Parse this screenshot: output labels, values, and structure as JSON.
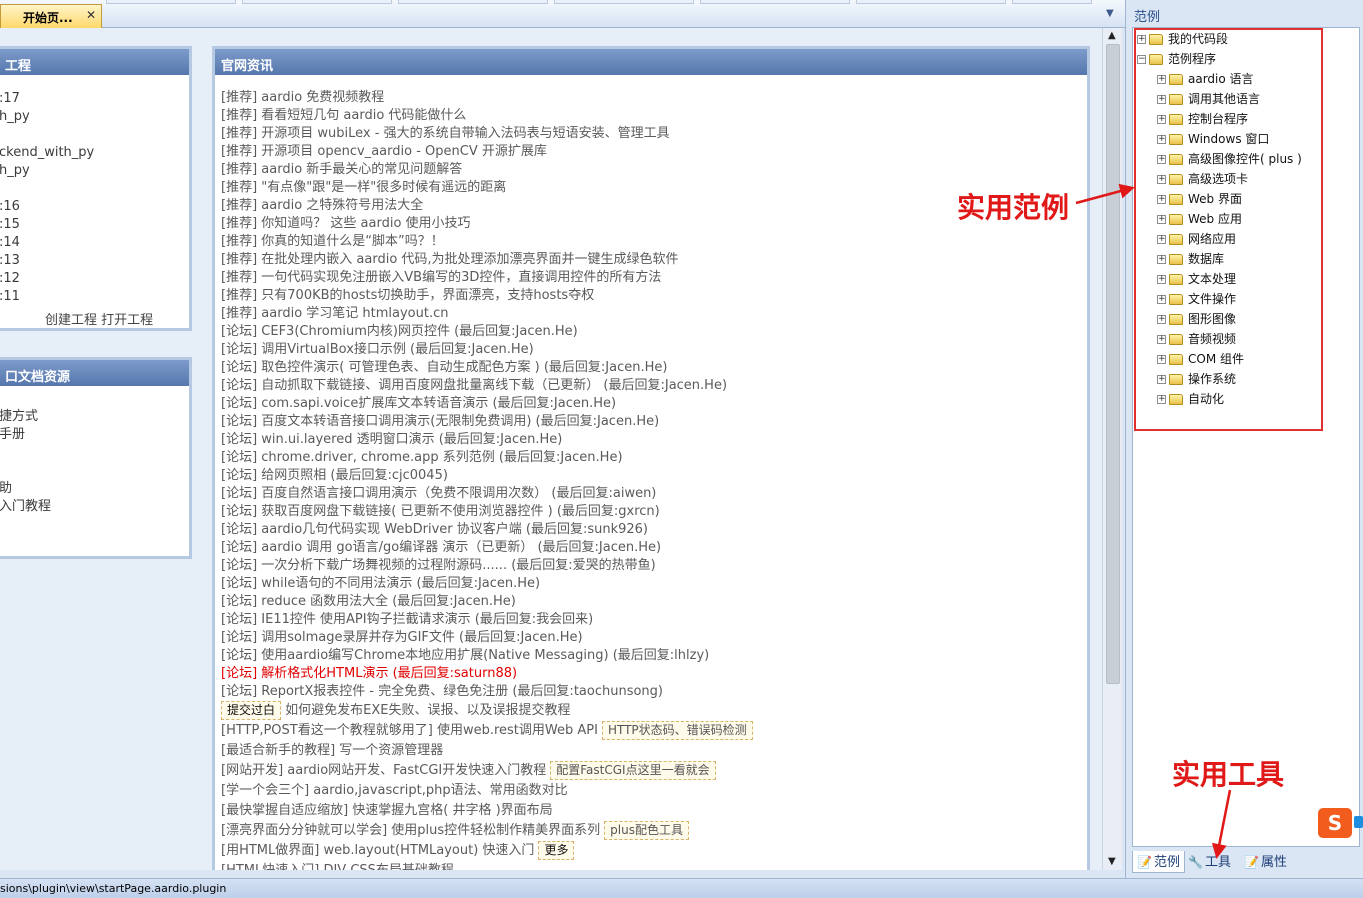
{
  "tab": {
    "label": "开始页...",
    "close": "✕"
  },
  "start_page": {
    "project_panel": {
      "title": "工程",
      "items": [
        ":17",
        "h_py",
        "",
        "ckend_with_py",
        "h_py",
        "",
        ":16",
        ":15",
        ":14",
        ":13",
        ":12",
        ":11"
      ],
      "create_link": "创建工程",
      "open_link": "打开工程"
    },
    "docs_panel": {
      "title": "口文档资源",
      "items": [
        "",
        "捷方式",
        "手册",
        "",
        "",
        "助",
        "入门教程"
      ]
    },
    "news_panel": {
      "title": "官网资讯",
      "items": [
        "[推荐] aardio 免费视频教程",
        "[推荐] 看看短短几句 aardio 代码能做什么",
        "[推荐] 开源项目 wubiLex - 强大的系统自带输入法码表与短语安装、管理工具",
        "[推荐] 开源项目 opencv_aardio - OpenCV 开源扩展库",
        "[推荐] aardio 新手最关心的常见问题解答",
        "[推荐] \"有点像\"跟\"是一样\"很多时候有遥远的距离",
        "[推荐] aardio 之特殊符号用法大全",
        "[推荐] 你知道吗？ 这些 aardio 使用小技巧",
        "[推荐] 你真的知道什么是“脚本”吗？！",
        "[推荐] 在批处理内嵌入 aardio 代码,为批处理添加漂亮界面并一键生成绿色软件",
        "[推荐] 一句代码实现免注册嵌入VB编写的3D控件，直接调用控件的所有方法",
        "[推荐] 只有700KB的hosts切换助手，界面漂亮，支持hosts夺权",
        "[推荐] aardio 学习笔记 htmlayout.cn",
        "[论坛] CEF3(Chromium内核)网页控件 (最后回复:Jacen.He)",
        "[论坛] 调用VirtualBox接口示例 (最后回复:Jacen.He)",
        "[论坛] 取色控件演示( 可管理色表、自动生成配色方案 ) (最后回复:Jacen.He)",
        "[论坛] 自动抓取下载链接、调用百度网盘批量离线下载（已更新） (最后回复:Jacen.He)",
        "[论坛] com.sapi.voice扩展库文本转语音演示 (最后回复:Jacen.He)",
        "[论坛] 百度文本转语音接口调用演示(无限制免费调用) (最后回复:Jacen.He)",
        "[论坛] win.ui.layered 透明窗口演示 (最后回复:Jacen.He)",
        "[论坛] chrome.driver, chrome.app 系列范例 (最后回复:Jacen.He)",
        "[论坛] 给网页照相 (最后回复:cjc0045)",
        "[论坛] 百度自然语言接口调用演示（免费不限调用次数） (最后回复:aiwen)",
        "[论坛] 获取百度网盘下载链接( 已更新不使用浏览器控件 ) (最后回复:gxrcn)",
        "[论坛] aardio几句代码实现 WebDriver 协议客户端 (最后回复:sunk926)",
        "[论坛] aardio 调用 go语言/go编译器 演示（已更新） (最后回复:Jacen.He)",
        "[论坛] 一次分析下载广场舞视频的过程附源码...... (最后回复:爱哭的热带鱼)",
        "[论坛] while语句的不同用法演示 (最后回复:Jacen.He)",
        "[论坛] reduce 函数用法大全 (最后回复:Jacen.He)",
        "[论坛] IE11控件 使用API钩子拦截请求演示 (最后回复:我会回来)",
        "[论坛] 调用solmage录屏并存为GIF文件 (最后回复:Jacen.He)",
        "[论坛] 使用aardio编写Chrome本地应用扩展(Native Messaging) (最后回复:lhlzy)"
      ],
      "hot_item": "[论坛] 解析格式化HTML演示 (最后回复:saturn88)",
      "item_after_hot": "[论坛] ReportX报表控件 - 完全免费、绿色免注册 (最后回复:taochunsong)",
      "extra_rows": [
        {
          "lead_btn": "提交过白",
          "text": " 如何避免发布EXE失败、误报、以及误报提交教程",
          "tag": ""
        },
        {
          "lead_btn": "",
          "text": "[HTTP,POST看这一个教程就够用了] 使用web.rest调用Web API",
          "tag": "HTTP状态码、错误码检测"
        },
        {
          "lead_btn": "",
          "text": "[最适合新手的教程] 写一个资源管理器",
          "tag": ""
        },
        {
          "lead_btn": "",
          "text": "[网站开发] aardio网站开发、FastCGI开发快速入门教程",
          "tag": "配置FastCGI点这里一看就会"
        },
        {
          "lead_btn": "",
          "text": "[学一个会三个] aardio,javascript,php语法、常用函数对比",
          "tag": ""
        },
        {
          "lead_btn": "",
          "text": "[最快掌握自适应缩放] 快速掌握九宫格( 井字格 )界面布局",
          "tag": ""
        },
        {
          "lead_btn": "",
          "text": "[漂亮界面分分钟就可以学会] 使用plus控件轻松制作精美界面系列",
          "tag": "plus配色工具"
        },
        {
          "lead_btn": "",
          "text": "[用HTML做界面] web.layout(HTMLayout) 快速入门",
          "tag": "更多"
        },
        {
          "lead_btn": "",
          "text": "[HTML快速入门] DIV CSS布局基础教程",
          "tag": ""
        }
      ]
    }
  },
  "sidebar": {
    "title": "范例",
    "tree": [
      {
        "label": "我的代码段",
        "level": 0,
        "expander": "+"
      },
      {
        "label": "范例程序",
        "level": 0,
        "expander": "−"
      },
      {
        "label": "aardio 语言",
        "level": 1,
        "expander": "+"
      },
      {
        "label": "调用其他语言",
        "level": 1,
        "expander": "+"
      },
      {
        "label": "控制台程序",
        "level": 1,
        "expander": "+"
      },
      {
        "label": "Windows 窗口",
        "level": 1,
        "expander": "+"
      },
      {
        "label": "高级图像控件( plus )",
        "level": 1,
        "expander": "+"
      },
      {
        "label": "高级选项卡",
        "level": 1,
        "expander": "+"
      },
      {
        "label": "Web 界面",
        "level": 1,
        "expander": "+"
      },
      {
        "label": "Web 应用",
        "level": 1,
        "expander": "+"
      },
      {
        "label": "网络应用",
        "level": 1,
        "expander": "+"
      },
      {
        "label": "数据库",
        "level": 1,
        "expander": "+"
      },
      {
        "label": "文本处理",
        "level": 1,
        "expander": "+"
      },
      {
        "label": "文件操作",
        "level": 1,
        "expander": "+"
      },
      {
        "label": "图形图像",
        "level": 1,
        "expander": "+"
      },
      {
        "label": "音频视频",
        "level": 1,
        "expander": "+"
      },
      {
        "label": "COM 组件",
        "level": 1,
        "expander": "+"
      },
      {
        "label": "操作系统",
        "level": 1,
        "expander": "+"
      },
      {
        "label": "自动化",
        "level": 1,
        "expander": "+"
      }
    ],
    "tabs": [
      {
        "label": "范例",
        "icon": "examples-icon",
        "active": true
      },
      {
        "label": "工具",
        "icon": "tools-icon",
        "active": false
      },
      {
        "label": "属性",
        "icon": "properties-icon",
        "active": false
      }
    ]
  },
  "annotations": {
    "examples_label": "实用范例",
    "tools_label": "实用工具",
    "color": "#e01818"
  },
  "statusbar": {
    "path": "sions\\plugin\\view\\startPage.aardio.plugin"
  }
}
